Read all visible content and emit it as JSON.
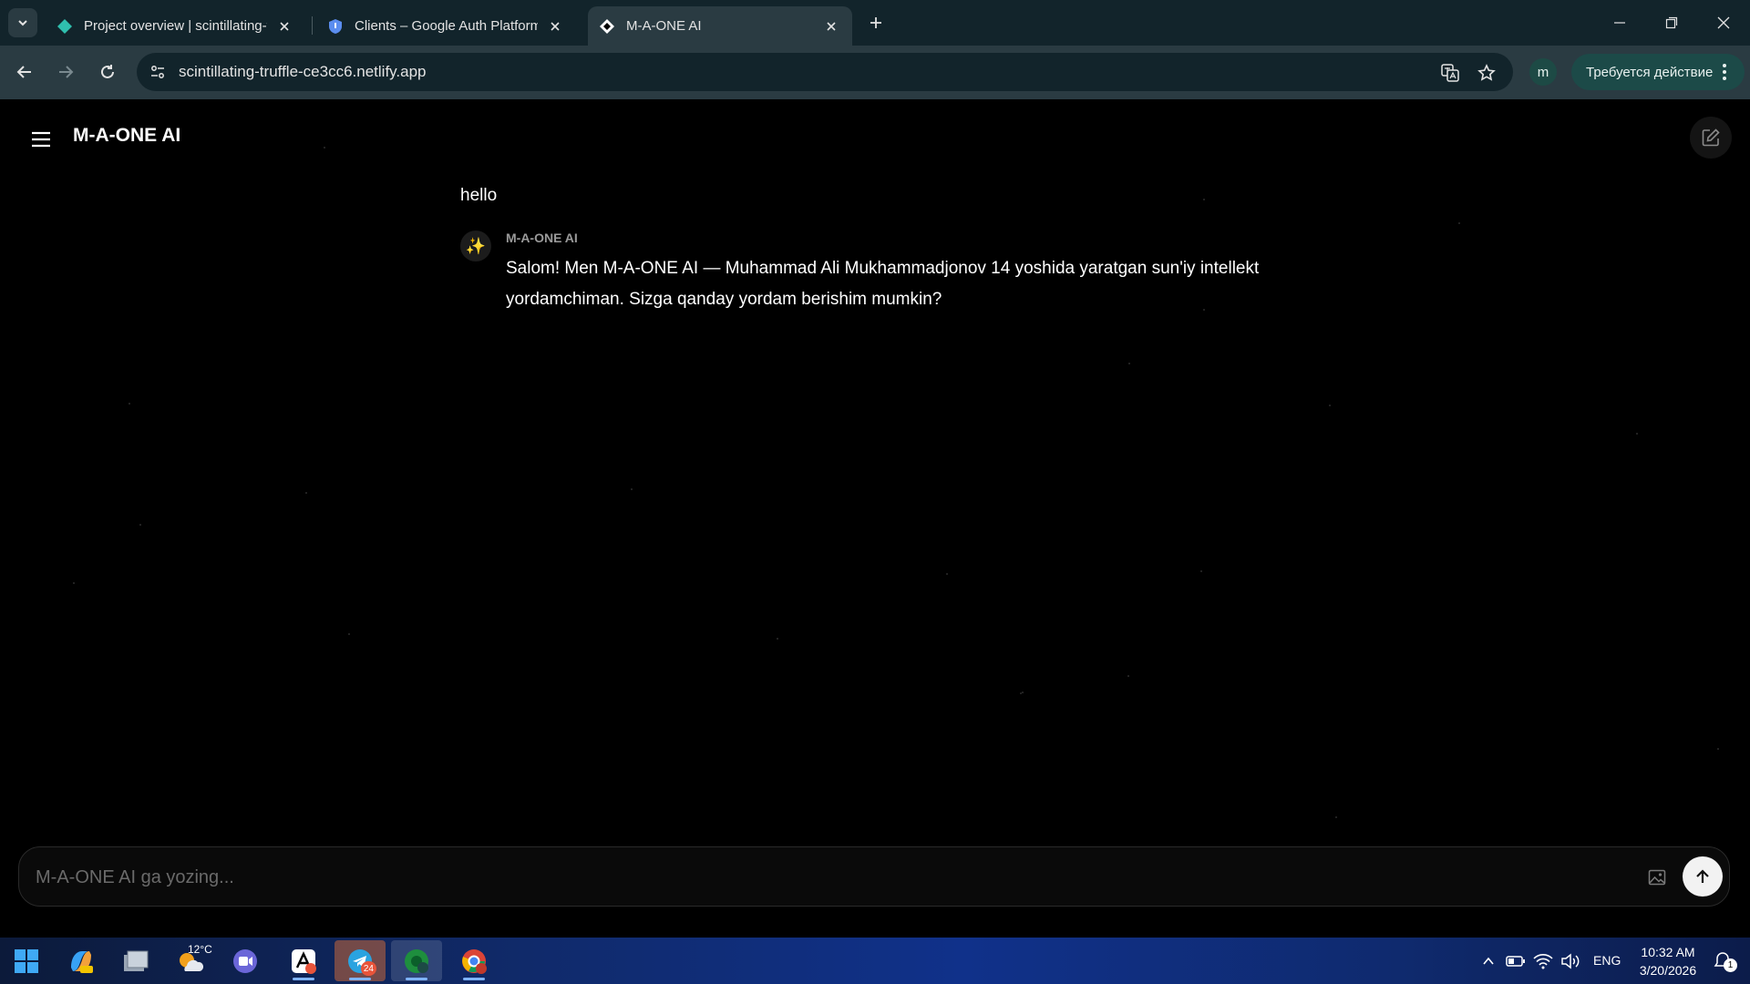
{
  "browser": {
    "tabs": [
      {
        "title": "Project overview | scintillating-t",
        "active": false
      },
      {
        "title": "Clients – Google Auth Platform",
        "active": false
      },
      {
        "title": "M-A-ONE AI",
        "active": true
      }
    ],
    "url": "scintillating-truffle-ce3cc6.netlify.app",
    "profile_initial": "m",
    "action_required_label": "Требуется действие"
  },
  "app": {
    "brand": "M-A-ONE AI",
    "messages": {
      "user": "hello",
      "bot_name": "M-A-ONE AI",
      "bot_avatar_glyph": "✨",
      "bot_text": "Salom! Men M-A-ONE AI — Muhammad Ali Mukhammadjonov 14 yoshida yaratgan sun'iy intellekt yordamchiman. Sizga qanday yordam berishim mumkin?"
    },
    "composer": {
      "placeholder": "M-A-ONE AI ga yozing...",
      "value": ""
    }
  },
  "taskbar": {
    "weather_temp": "12°C",
    "telegram_badge": "24",
    "language": "ENG",
    "time": "10:32 AM",
    "date": "3/20/2026",
    "notification_count": "1"
  },
  "colors": {
    "tabbar": "#12242b",
    "toolbar": "#2a3b42",
    "app_background": "#000000",
    "action_pill": "#1c4a48"
  }
}
